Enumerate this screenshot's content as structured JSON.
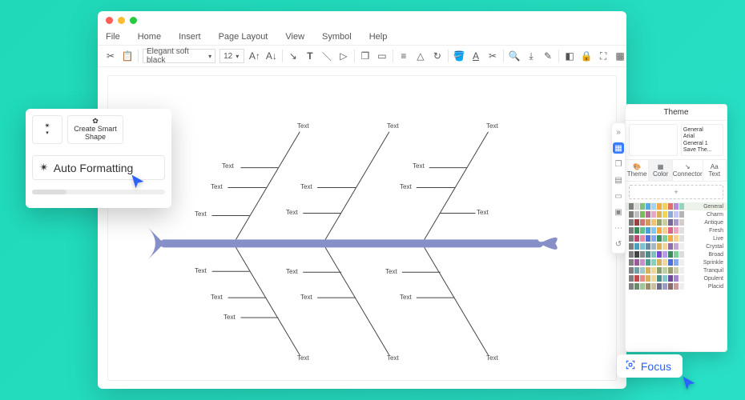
{
  "menu": {
    "file": "File",
    "home": "Home",
    "insert": "Insert",
    "page_layout": "Page Layout",
    "view": "View",
    "symbol": "Symbol",
    "help": "Help"
  },
  "toolbar": {
    "font_name": "Elegant soft black",
    "font_size": "12"
  },
  "auto_card": {
    "create_smart_shape": "Create Smart Shape",
    "auto_formatting": "Auto Formatting"
  },
  "theme": {
    "title": "Theme",
    "tabs": {
      "theme": "Theme",
      "color": "Color",
      "connector": "Connector",
      "text": "Text"
    },
    "preview_side": [
      "General",
      "Arial",
      "General 1",
      "Save The..."
    ],
    "palettes": [
      "General",
      "Charm",
      "Antique",
      "Fresh",
      "Live",
      "Crystal",
      "Broad",
      "Sprinkle",
      "Tranquil",
      "Opulent",
      "Placid"
    ]
  },
  "focus": {
    "label": "Focus"
  },
  "fishbone": {
    "label": "Text"
  },
  "colors": {
    "accent": "#878fc9",
    "cursor": "#2a63ff"
  },
  "palette_rows": [
    [
      "#7f7f7f",
      "#d9d9d9",
      "#7fbf7f",
      "#5aa9e6",
      "#9fd6f2",
      "#f4aa42",
      "#f2d35a",
      "#e26c6c",
      "#b58add",
      "#92d4c0"
    ],
    [
      "#7f7f7f",
      "#bfbfbf",
      "#7bba5a",
      "#b06d9a",
      "#e7a7c6",
      "#d8b25a",
      "#f2d35a",
      "#93a7d6",
      "#c4c4ff",
      "#b5b5b5"
    ],
    [
      "#7f7f7f",
      "#994444",
      "#cc7777",
      "#d39b5a",
      "#f2c177",
      "#9aa26b",
      "#c7cf9c",
      "#77669a",
      "#a998cc",
      "#d7cccc"
    ],
    [
      "#7f7f7f",
      "#3a8c5a",
      "#63c084",
      "#4a9fd5",
      "#82c8f0",
      "#f4aa42",
      "#f7cf8c",
      "#d8658b",
      "#f0a6c1",
      "#e0e0e0"
    ],
    [
      "#7f7f7f",
      "#b84a6e",
      "#e78aa8",
      "#4a6fd5",
      "#8aa8f0",
      "#3a8c5a",
      "#7ed09a",
      "#f4aa42",
      "#f7d38c",
      "#e0e0e0"
    ],
    [
      "#7f7f7f",
      "#4aa0b8",
      "#7bc3d4",
      "#6a8aa6",
      "#a3b7c8",
      "#d8b25a",
      "#f2d59a",
      "#8e6da6",
      "#c2a7d2",
      "#eeeeee"
    ],
    [
      "#7f7f7f",
      "#444444",
      "#888888",
      "#4a8c8c",
      "#7fc2c2",
      "#7a4acc",
      "#b59af0",
      "#3a8c5a",
      "#7ed09a",
      "#dddddd"
    ],
    [
      "#7f7f7f",
      "#9c5a9c",
      "#c78fc7",
      "#4aa08c",
      "#86d0bf",
      "#d8b25a",
      "#f2d59a",
      "#4a6fd5",
      "#8aa8f0",
      "#eeeeee"
    ],
    [
      "#7f7f7f",
      "#6fa0a6",
      "#a0c8cc",
      "#d8b25a",
      "#f2d59a",
      "#8aa06f",
      "#bbd19f",
      "#9c9c6f",
      "#ccccaa",
      "#eeeeee"
    ],
    [
      "#7f7f7f",
      "#c44a4a",
      "#e88a8a",
      "#d8b25a",
      "#f2d59a",
      "#4a8c8c",
      "#86c8c8",
      "#6a4a9c",
      "#a786d0",
      "#eeeeee"
    ],
    [
      "#7f7f7f",
      "#6a8c6a",
      "#9cc69c",
      "#9c8c6a",
      "#ccc09c",
      "#6a6a8c",
      "#9c9cc6",
      "#8c6a6a",
      "#c69c9c",
      "#eeeeee"
    ]
  ]
}
